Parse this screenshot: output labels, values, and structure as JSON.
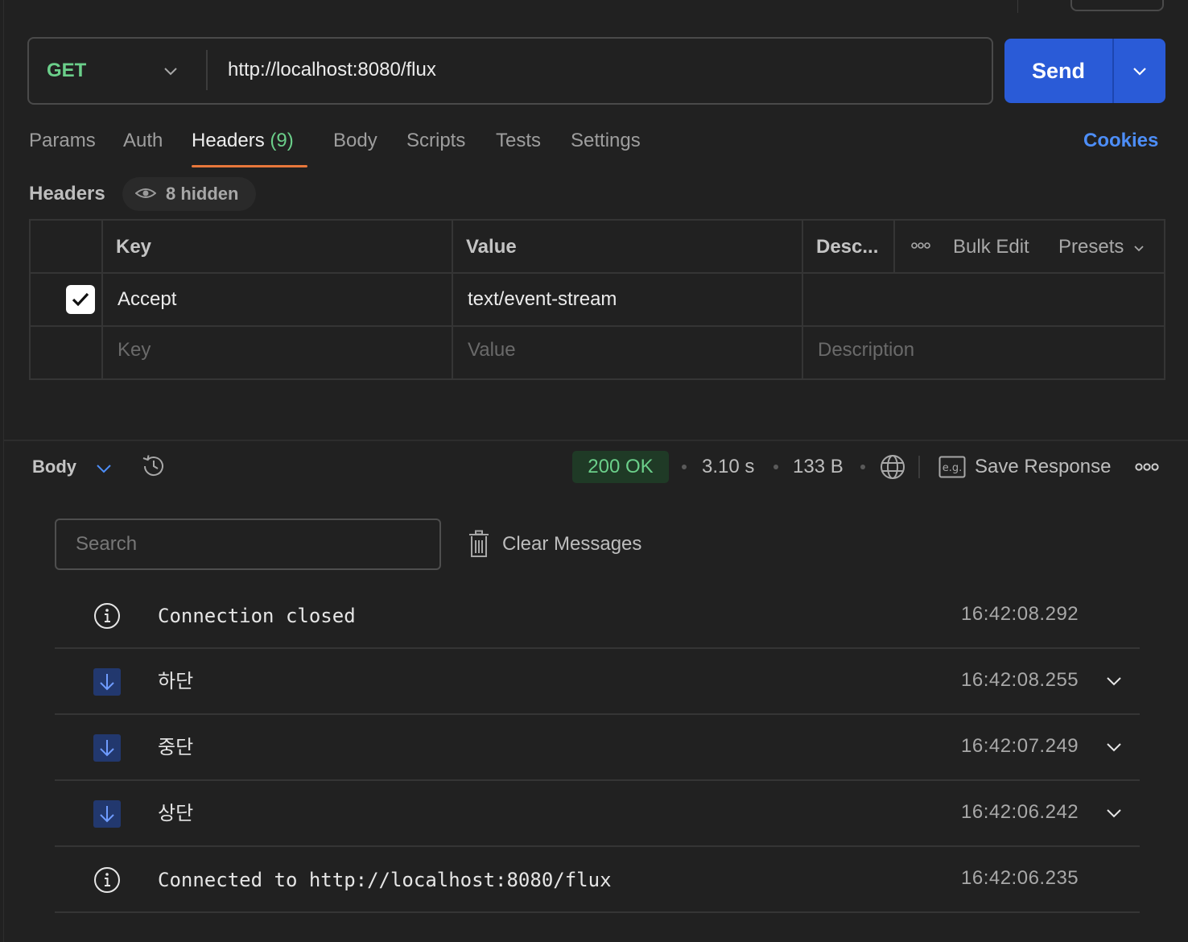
{
  "request": {
    "method": "GET",
    "url": "http://localhost:8080/flux",
    "send_label": "Send"
  },
  "tabs": [
    {
      "label": "Params"
    },
    {
      "label": "Auth"
    },
    {
      "label": "Headers",
      "count": "(9)",
      "active": true
    },
    {
      "label": "Body"
    },
    {
      "label": "Scripts"
    },
    {
      "label": "Tests"
    },
    {
      "label": "Settings"
    }
  ],
  "cookies_label": "Cookies",
  "headers_section": {
    "title": "Headers",
    "hidden_label": "8 hidden",
    "columns": {
      "key": "Key",
      "value": "Value",
      "description": "Desc..."
    },
    "tools": {
      "bulk_edit": "Bulk Edit",
      "presets": "Presets"
    },
    "rows": [
      {
        "checked": true,
        "key": "Accept",
        "value": "text/event-stream",
        "description": ""
      }
    ],
    "placeholders": {
      "key": "Key",
      "value": "Value",
      "description": "Description"
    }
  },
  "response": {
    "body_label": "Body",
    "status": "200 OK",
    "time": "3.10 s",
    "size": "133 B",
    "save_label": "Save Response",
    "colors": {
      "status_text": "#6bcf8a",
      "status_bg": "#1f3a26",
      "accent": "#2a5bd7"
    }
  },
  "messages": {
    "search_placeholder": "Search",
    "clear_label": "Clear Messages",
    "items": [
      {
        "type": "info",
        "text": "Connection closed",
        "time": "16:42:08.292"
      },
      {
        "type": "incoming",
        "text": "하단",
        "time": "16:42:08.255"
      },
      {
        "type": "incoming",
        "text": "중단",
        "time": "16:42:07.249"
      },
      {
        "type": "incoming",
        "text": "상단",
        "time": "16:42:06.242"
      },
      {
        "type": "info",
        "text": "Connected to http://localhost:8080/flux",
        "time": "16:42:06.235"
      }
    ]
  }
}
